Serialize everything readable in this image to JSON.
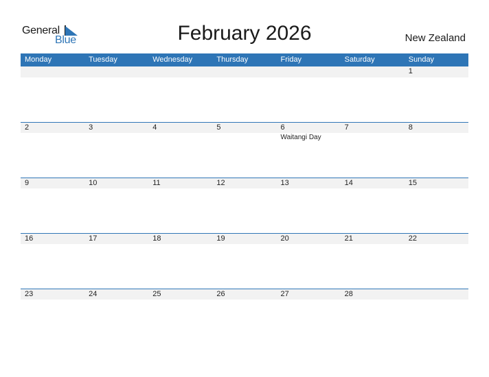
{
  "logo": {
    "line1": "General",
    "line2": "Blue",
    "accent": "#2e75b6"
  },
  "title": "February 2026",
  "country": "New Zealand",
  "colors": {
    "header_bg": "#2e75b6",
    "day_row_bg": "#f2f2f2"
  },
  "weekdays": [
    "Monday",
    "Tuesday",
    "Wednesday",
    "Thursday",
    "Friday",
    "Saturday",
    "Sunday"
  ],
  "weeks": [
    {
      "days": [
        "",
        "",
        "",
        "",
        "",
        "",
        "1"
      ],
      "events": [
        "",
        "",
        "",
        "",
        "",
        "",
        ""
      ]
    },
    {
      "days": [
        "2",
        "3",
        "4",
        "5",
        "6",
        "7",
        "8"
      ],
      "events": [
        "",
        "",
        "",
        "",
        "Waitangi Day",
        "",
        ""
      ]
    },
    {
      "days": [
        "9",
        "10",
        "11",
        "12",
        "13",
        "14",
        "15"
      ],
      "events": [
        "",
        "",
        "",
        "",
        "",
        "",
        ""
      ]
    },
    {
      "days": [
        "16",
        "17",
        "18",
        "19",
        "20",
        "21",
        "22"
      ],
      "events": [
        "",
        "",
        "",
        "",
        "",
        "",
        ""
      ]
    },
    {
      "days": [
        "23",
        "24",
        "25",
        "26",
        "27",
        "28",
        ""
      ],
      "events": [
        "",
        "",
        "",
        "",
        "",
        "",
        ""
      ]
    }
  ]
}
